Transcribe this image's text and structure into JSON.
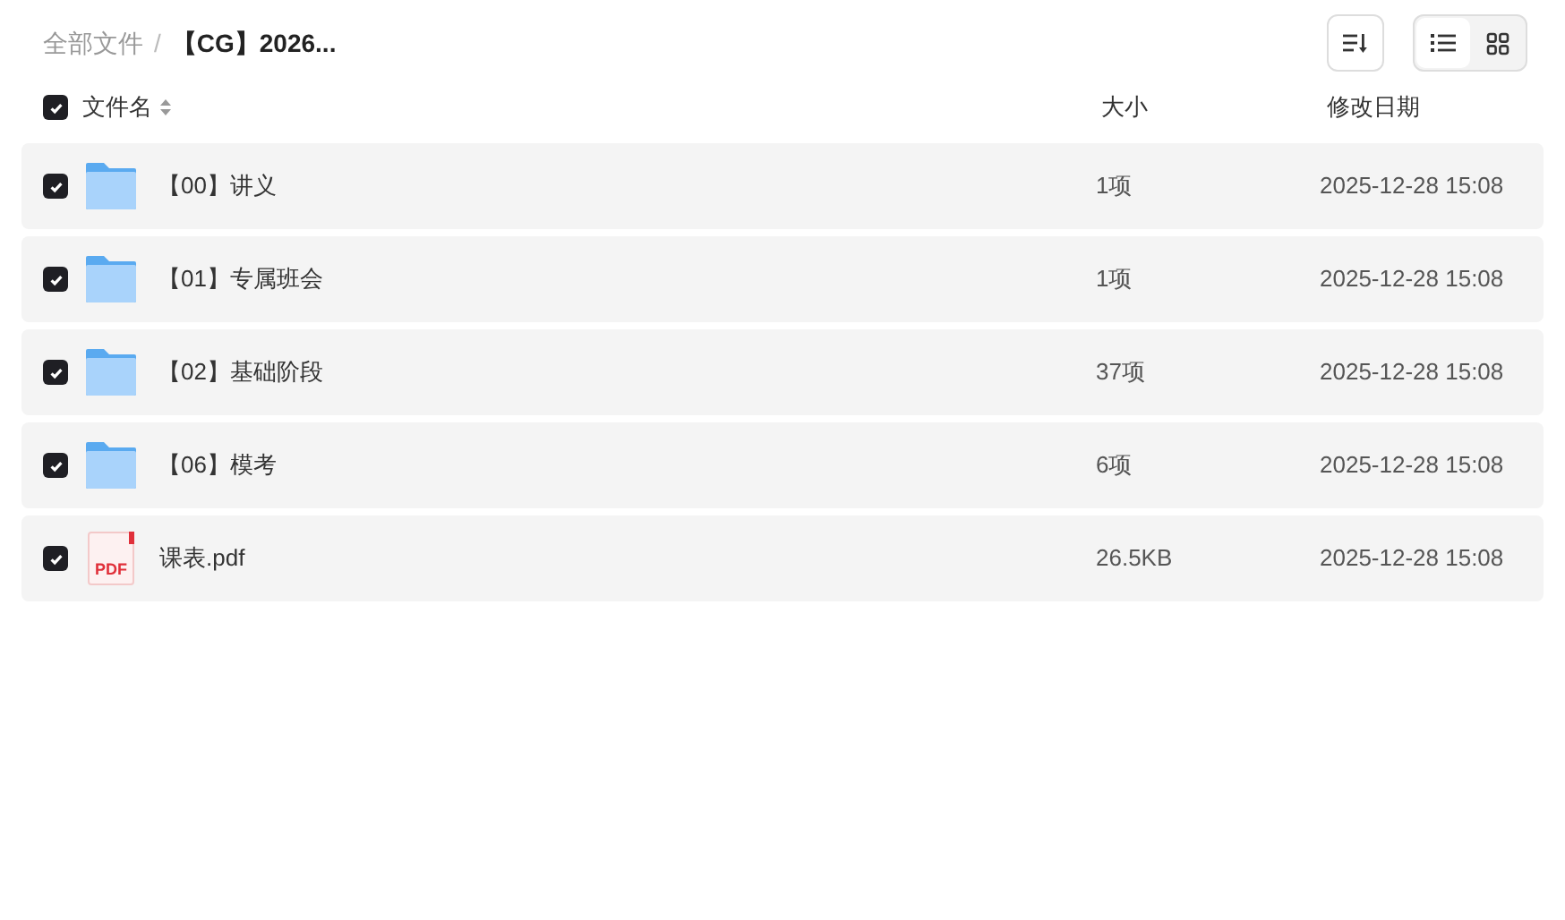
{
  "breadcrumb": [
    {
      "label": "全部文件",
      "current": false
    },
    {
      "separator": "/",
      "label": "【CG】2026..."
    }
  ],
  "toolbar": {
    "views": [
      {
        "kind": "list",
        "selected": true
      },
      {
        "kind": "grid",
        "selected": false
      }
    ]
  },
  "table": {
    "select_all": {
      "checked": true
    },
    "columns": [
      "文件名",
      "大小",
      "修改日期"
    ],
    "rows": [
      {
        "kind": "folder",
        "checked": true,
        "name": "【00】讲义",
        "size": "1项",
        "modified": "2025-12-28 15:08"
      },
      {
        "kind": "folder",
        "checked": true,
        "name": "【01】专属班会",
        "size": "1项",
        "modified": "2025-12-28 15:08"
      },
      {
        "kind": "folder",
        "checked": true,
        "name": "【02】基础阶段",
        "size": "37项",
        "modified": "2025-12-28 15:08"
      },
      {
        "kind": "folder",
        "checked": true,
        "name": "【06】模考",
        "size": "6项",
        "modified": "2025-12-28 15:08"
      },
      {
        "kind": "pdf",
        "icon_text": "PDF",
        "checked": true,
        "name": "课表.pdf",
        "size": "26.5KB",
        "modified": "2025-12-28 15:08"
      }
    ]
  }
}
